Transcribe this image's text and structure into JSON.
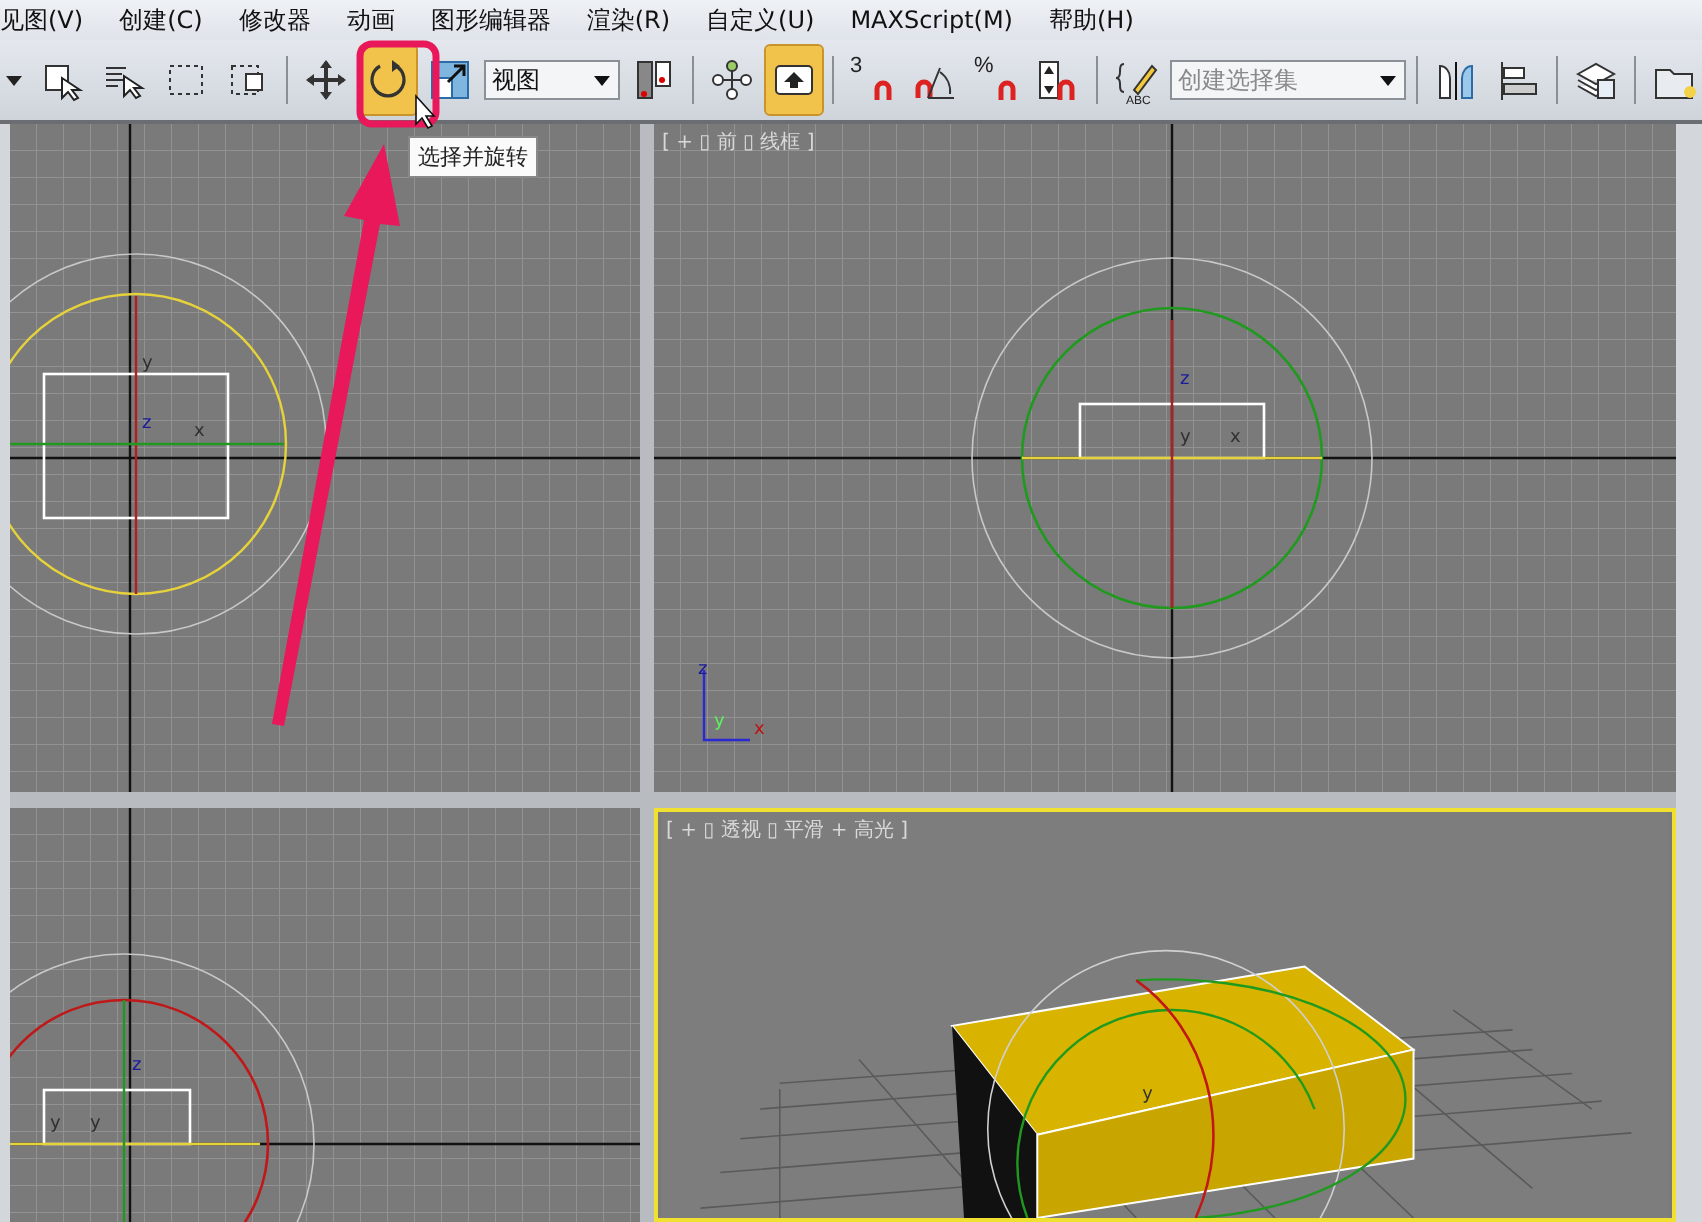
{
  "menu": [
    "见图(V)",
    "创建(C)",
    "修改器",
    "动画",
    "图形编辑器",
    "渲染(R)",
    "自定义(U)",
    "MAXScript(M)",
    "帮助(H)"
  ],
  "toolbar": [
    {
      "kind": "stub",
      "on": false
    },
    {
      "kind": "select-object",
      "on": false
    },
    {
      "kind": "select-by-name",
      "on": false
    },
    {
      "kind": "rect-region",
      "on": false
    },
    {
      "kind": "window-crossing",
      "on": false
    },
    {
      "kind": "sep"
    },
    {
      "kind": "move",
      "on": false
    },
    {
      "kind": "rotate",
      "on": true
    },
    {
      "kind": "scale",
      "on": false
    },
    {
      "kind": "combo",
      "value": "视图"
    },
    {
      "kind": "pivot",
      "on": false
    },
    {
      "kind": "sep"
    },
    {
      "kind": "manipulate",
      "on": false
    },
    {
      "kind": "shortcut",
      "on": true
    },
    {
      "kind": "sep"
    },
    {
      "kind": "snap",
      "on": false,
      "glyph": "3"
    },
    {
      "kind": "angle-snap",
      "on": false
    },
    {
      "kind": "snap",
      "on": false,
      "glyph": "%"
    },
    {
      "kind": "spinner-snap",
      "on": false
    },
    {
      "kind": "sep"
    },
    {
      "kind": "named-sets",
      "on": false,
      "glyph": "ABC"
    },
    {
      "kind": "combo-wide",
      "placeholder": "创建选择集"
    },
    {
      "kind": "sep"
    },
    {
      "kind": "mirror",
      "on": false
    },
    {
      "kind": "align",
      "on": false
    },
    {
      "kind": "sep"
    },
    {
      "kind": "layer",
      "on": false
    },
    {
      "kind": "sep"
    },
    {
      "kind": "graphite",
      "on": false
    }
  ],
  "tooltip": "选择并旋转",
  "viewports": [
    {
      "kind": "top",
      "active": false,
      "axis_labels": [
        "y",
        "z",
        "x"
      ]
    },
    {
      "kind": "front",
      "active": false,
      "label": "[ + ▯ 前 ▯ 线框 ]",
      "axis_labels": [
        "z",
        "y",
        "x"
      ],
      "tripod_labels": [
        "z",
        "y",
        "x"
      ]
    },
    {
      "kind": "left",
      "active": false,
      "axis_labels": [
        "z",
        "y",
        "y"
      ]
    },
    {
      "kind": "perspective",
      "active": true,
      "label": "[ + ▯ 透视 ▯ 平滑 + 高光 ]",
      "axis_labels": [
        "y"
      ]
    }
  ]
}
